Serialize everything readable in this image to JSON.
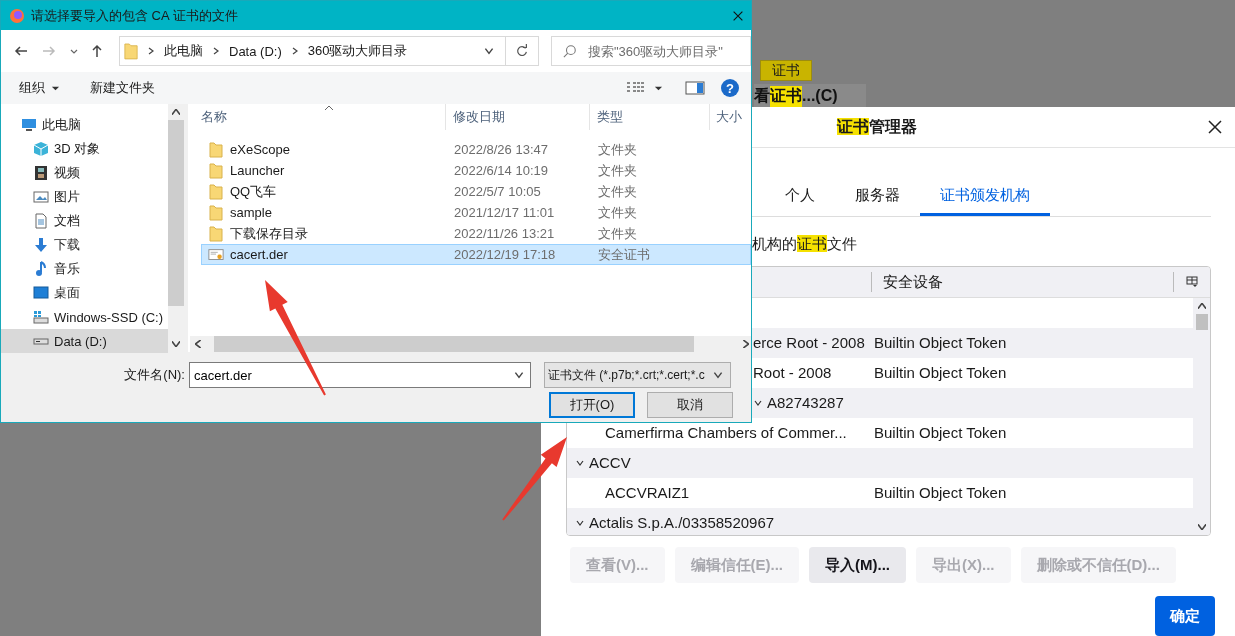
{
  "background_page": {
    "tooltip": "证书",
    "button_parts": [
      {
        "text": "看",
        "highlight": false
      },
      {
        "text": "证书",
        "highlight": true
      },
      {
        "text": "...(C)",
        "highlight": false
      }
    ]
  },
  "cert_manager": {
    "title_parts": [
      {
        "text": "证书",
        "highlight": true
      },
      {
        "text": "管理器",
        "highlight": false
      }
    ],
    "tabs": [
      {
        "label": "个人",
        "selected": false
      },
      {
        "label": "服务器",
        "selected": false
      },
      {
        "label": "证书颁发机构",
        "selected": true
      }
    ],
    "description_parts": [
      {
        "text": "机构的",
        "highlight": false
      },
      {
        "text": "证书",
        "highlight": true
      },
      {
        "text": "文件",
        "highlight": false
      }
    ],
    "table": {
      "column_2": "安全设备",
      "rows": [
        {
          "kind": "cert",
          "name": "erce Root - 2008",
          "device": "Builtin Object Token",
          "cut_by_dialog": true
        },
        {
          "kind": "cert",
          "name": "Root - 2008",
          "device": "Builtin Object Token",
          "cut_by_dialog": true
        },
        {
          "kind": "group",
          "name": "A82743287",
          "expanded": true,
          "cut_by_dialog": true
        },
        {
          "kind": "cert",
          "name": "Camerfirma Chambers of Commer...",
          "device": "Builtin Object Token",
          "cut_by_dialog": false
        },
        {
          "kind": "group",
          "name": "ACCV",
          "expanded": true,
          "cut_by_dialog": false
        },
        {
          "kind": "cert",
          "name": "ACCVRAIZ1",
          "device": "Builtin Object Token",
          "cut_by_dialog": false
        },
        {
          "kind": "group",
          "name": "Actalis S.p.A./03358520967",
          "expanded": true,
          "cut_by_dialog": false
        }
      ]
    },
    "buttons": [
      {
        "label": "查看(V)...",
        "disabled": true
      },
      {
        "label": "编辑信任(E)...",
        "disabled": true
      },
      {
        "label": "导入(M)...",
        "disabled": false
      },
      {
        "label": "导出(X)...",
        "disabled": true
      },
      {
        "label": "删除或不信任(D)...",
        "disabled": true
      }
    ],
    "ok_button": "确定"
  },
  "file_dialog": {
    "title": "请选择要导入的包含 CA 证书的文件",
    "crumbs": [
      "此电脑",
      "Data (D:)",
      "360驱动大师目录"
    ],
    "search_placeholder": "搜索\"360驱动大师目录\"",
    "organize": "组织",
    "new_folder": "新建文件夹",
    "help": "?",
    "sidebar": [
      {
        "label": "此电脑",
        "kind": "pc",
        "selected": false,
        "children": [
          {
            "label": "3D 对象",
            "kind": "objects",
            "selected": false
          },
          {
            "label": "视频",
            "kind": "video",
            "selected": false
          },
          {
            "label": "图片",
            "kind": "pictures",
            "selected": false
          },
          {
            "label": "文档",
            "kind": "documents",
            "selected": false
          },
          {
            "label": "下载",
            "kind": "downloads",
            "selected": false
          },
          {
            "label": "音乐",
            "kind": "music",
            "selected": false
          },
          {
            "label": "桌面",
            "kind": "desktop",
            "selected": false
          },
          {
            "label": "Windows-SSD (C:)",
            "kind": "system",
            "selected": false
          },
          {
            "label": "Data (D:)",
            "kind": "drive",
            "selected": true
          }
        ]
      }
    ],
    "columns": [
      "名称",
      "修改日期",
      "类型",
      "大小"
    ],
    "files": [
      {
        "name": "eXeScope",
        "date": "2022/8/26 13:47",
        "type": "文件夹",
        "kind": "folder",
        "selected": false
      },
      {
        "name": "Launcher",
        "date": "2022/6/14 10:19",
        "type": "文件夹",
        "kind": "folder",
        "selected": false
      },
      {
        "name": "QQ飞车",
        "date": "2022/5/7 10:05",
        "type": "文件夹",
        "kind": "folder",
        "selected": false
      },
      {
        "name": "sample",
        "date": "2021/12/17 11:01",
        "type": "文件夹",
        "kind": "folder",
        "selected": false
      },
      {
        "name": "下载保存目录",
        "date": "2022/11/26 13:21",
        "type": "文件夹",
        "kind": "folder",
        "selected": false
      },
      {
        "name": "cacert.der",
        "date": "2022/12/19 17:18",
        "type": "安全证书",
        "kind": "certificate",
        "selected": true
      }
    ],
    "filename_label": "文件名(N):",
    "filename": "cacert.der",
    "filter": "证书文件 (*.p7b;*.crt;*.cert;*.c",
    "open_button": "打开(O)",
    "cancel_button": "取消"
  }
}
